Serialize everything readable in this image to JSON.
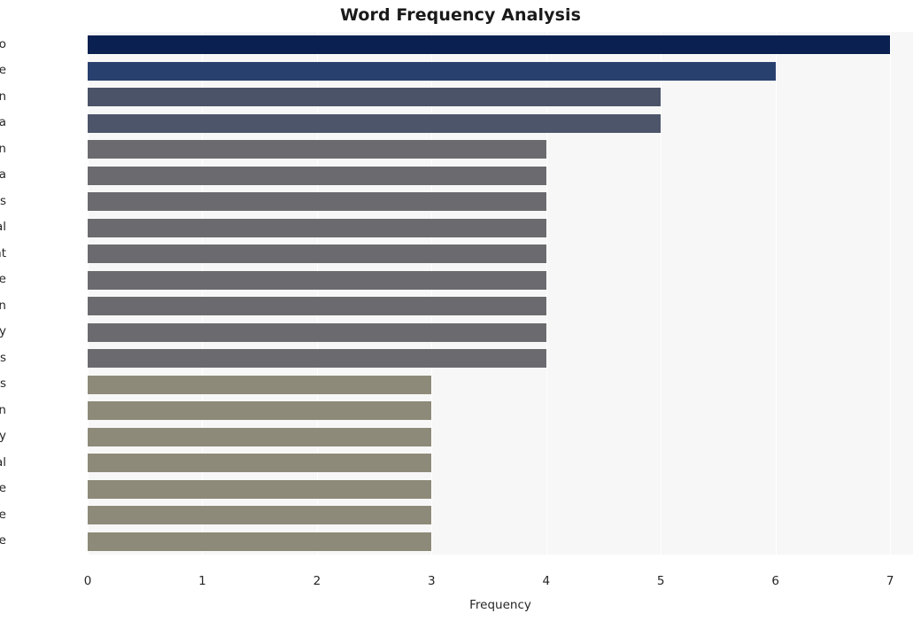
{
  "chart_data": {
    "type": "bar",
    "orientation": "horizontal",
    "title": "Word Frequency Analysis",
    "xlabel": "Frequency",
    "ylabel": "",
    "xlim": [
      0,
      7.2
    ],
    "xticks": [
      "0",
      "1",
      "2",
      "3",
      "4",
      "5",
      "6",
      "7"
    ],
    "xtick_values": [
      0,
      1,
      2,
      3,
      4,
      5,
      6,
      7
    ],
    "grid": "vertical-white-on-gray",
    "legend": "none",
    "categories": [
      "maduro",
      "state",
      "venezuelan",
      "venezuela",
      "sanction",
      "visa",
      "individuals",
      "electoral",
      "department",
      "take",
      "action",
      "treasury",
      "officials",
      "restrictions",
      "align",
      "today",
      "presidential",
      "people",
      "include",
      "undermine"
    ],
    "values": [
      7,
      6,
      5,
      5,
      4,
      4,
      4,
      4,
      4,
      4,
      4,
      4,
      4,
      3,
      3,
      3,
      3,
      3,
      3,
      3
    ],
    "bar_colors": [
      "#0a2050",
      "#28406e",
      "#4b5368",
      "#4d556b",
      "#6b6b6f",
      "#6b6b6f",
      "#6b6b6f",
      "#6b6b6f",
      "#6b6b6f",
      "#6b6b6f",
      "#6b6b6f",
      "#6b6b6f",
      "#6b6b6f",
      "#8e8a79",
      "#8e8a79",
      "#8e8a79",
      "#8e8a79",
      "#8e8a79",
      "#8e8a79",
      "#8e8a79"
    ]
  },
  "style": {
    "figure_background": "#ffffff",
    "plot_background": "#f7f7f7",
    "gridline_color": "#ffffff",
    "text_color": "#262626",
    "title_color": "#1a1a1a"
  }
}
